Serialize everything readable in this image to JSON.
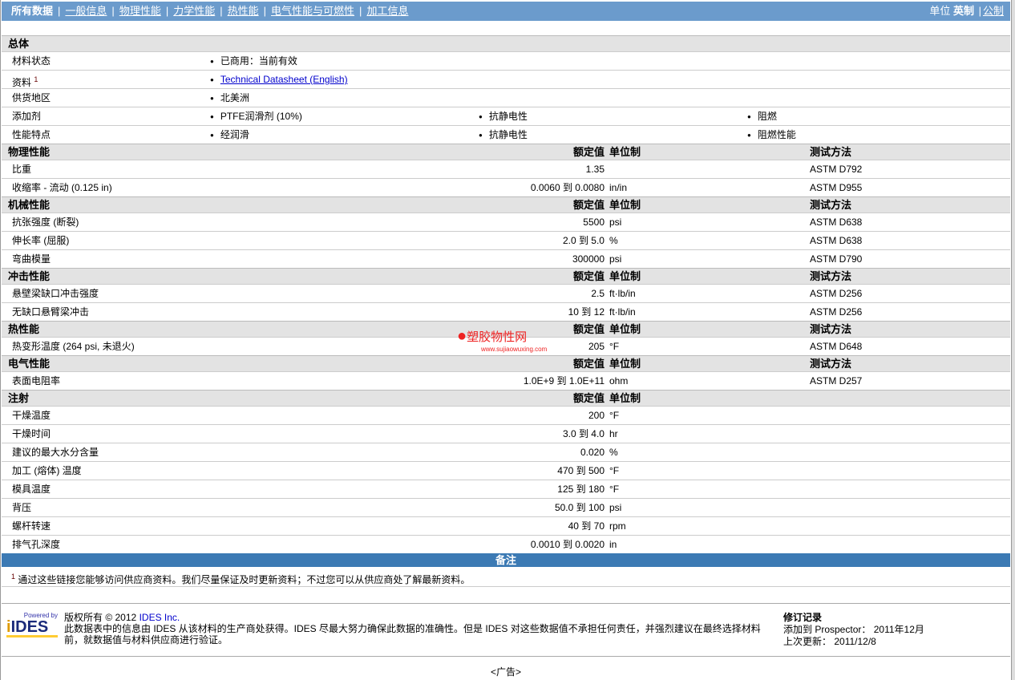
{
  "nav": {
    "items": [
      "所有数据",
      "一般信息",
      "物理性能",
      "力学性能",
      "热性能",
      "电气性能与可燃性",
      "加工信息"
    ],
    "unit_label": "单位",
    "unit_active": "英制",
    "unit_other": "公制"
  },
  "general": {
    "title": "总体",
    "rows": [
      {
        "label": "材料状态",
        "values": [
          "已商用：当前有效"
        ]
      },
      {
        "label": "资料",
        "sup": "1",
        "link": "Technical Datasheet (English)"
      },
      {
        "label": "供货地区",
        "values": [
          "北美洲"
        ]
      },
      {
        "label": "添加剂",
        "values": [
          "PTFE润滑剂 (10%)",
          "抗静电性",
          "阻燃"
        ]
      },
      {
        "label": "性能特点",
        "values": [
          "经润滑",
          "抗静电性",
          "阻燃性能"
        ]
      }
    ]
  },
  "headers": {
    "value": "额定值",
    "unit": "单位制",
    "method": "测试方法"
  },
  "sections": [
    {
      "title": "物理性能",
      "method": true,
      "rows": [
        [
          "比重",
          "1.35",
          "",
          "ASTM D792"
        ],
        [
          "收缩率 - 流动 (0.125 in)",
          "0.0060 到  0.0080",
          "in/in",
          "ASTM D955"
        ]
      ]
    },
    {
      "title": "机械性能",
      "method": true,
      "rows": [
        [
          "抗张强度 (断裂)",
          "5500",
          "psi",
          "ASTM D638"
        ],
        [
          "伸长率 (屈服)",
          "2.0 到  5.0",
          "%",
          "ASTM D638"
        ],
        [
          "弯曲模量",
          "300000",
          "psi",
          "ASTM D790"
        ]
      ]
    },
    {
      "title": "冲击性能",
      "method": true,
      "rows": [
        [
          "悬壁梁缺口冲击强度",
          "2.5",
          "ft·lb/in",
          "ASTM D256"
        ],
        [
          "无缺口悬臂梁冲击",
          "10 到  12",
          "ft·lb/in",
          "ASTM D256"
        ]
      ]
    },
    {
      "title": "热性能",
      "method": true,
      "rows": [
        [
          "热变形温度 (264 psi, 未退火)",
          "205",
          "°F",
          "ASTM D648"
        ]
      ]
    },
    {
      "title": "电气性能",
      "method": true,
      "rows": [
        [
          "表面电阻率",
          "1.0E+9 到  1.0E+11",
          "ohm",
          "ASTM D257"
        ]
      ]
    },
    {
      "title": "注射",
      "method": false,
      "rows": [
        [
          "干燥温度",
          "200",
          "°F",
          ""
        ],
        [
          "干燥时间",
          "3.0 到  4.0",
          "hr",
          ""
        ],
        [
          "建议的最大水分含量",
          "0.020",
          "%",
          ""
        ],
        [
          "加工 (熔体) 温度",
          "470 到  500",
          "°F",
          ""
        ],
        [
          "模具温度",
          "125 到  180",
          "°F",
          ""
        ],
        [
          "背压",
          "50.0 到  100",
          "psi",
          ""
        ],
        [
          "螺杆转速",
          "40 到  70",
          "rpm",
          ""
        ],
        [
          "排气孔深度",
          "0.0010 到  0.0020",
          "in",
          ""
        ]
      ]
    }
  ],
  "notes": {
    "title": "备注",
    "sup": "1",
    "text": "通过这些链接您能够访问供应商资料。我们尽量保证及时更新资料；不过您可以从供应商处了解最新资料。"
  },
  "footer": {
    "logo_small": "Powered by",
    "logo": "IDES",
    "copyright": "版权所有  © 2012",
    "company": "IDES Inc.",
    "disclaimer": "此数据表中的信息由 IDES 从该材料的生产商处获得。IDES 尽最大努力确保此数据的准确性。但是 IDES 对这些数据值不承担任何责任，并强烈建议在最终选择材料前，就数据值与材料供应商进行验证。",
    "rev_title": "修订记录",
    "added_label": "添加到 Prospector：",
    "added": "2011年12月",
    "updated_label": "上次更新：",
    "updated": "2011/12/8"
  },
  "ad": "<广告>",
  "watermark": {
    "title": "塑胶物性网",
    "url": "www.sujiaowuxing.com"
  }
}
